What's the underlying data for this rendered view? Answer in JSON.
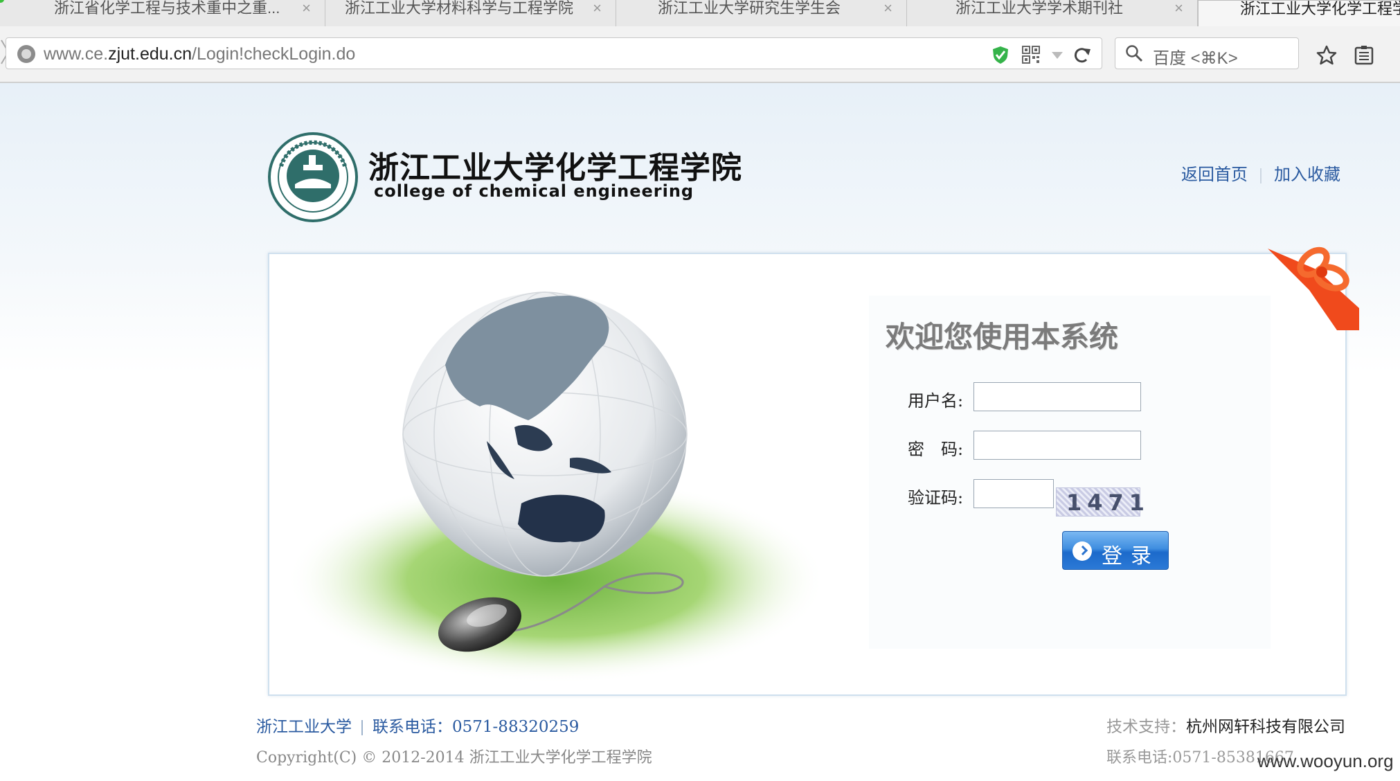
{
  "browser": {
    "tabs": [
      {
        "title": "浙江省化学工程与技术重中之重...",
        "close": "×"
      },
      {
        "title": "浙江工业大学材料科学与工程学院",
        "close": "×"
      },
      {
        "title": "浙江工业大学研究生学生会",
        "close": "×"
      },
      {
        "title": "浙江工业大学学术期刊社",
        "close": "×"
      },
      {
        "title": "浙江工业大学化学工程学",
        "close": ""
      }
    ],
    "url_prefix": "www.ce.",
    "url_domain": "zjut.edu.cn",
    "url_path": "/Login!checkLogin.do",
    "search_placeholder": "百度 <⌘K>",
    "icons": [
      "globe-icon",
      "shield-check-icon",
      "qrcode-icon",
      "dropdown-triangle-icon",
      "reload-icon",
      "search-icon",
      "star-icon",
      "reading-list-icon"
    ]
  },
  "header": {
    "title": "浙江工业大学化学工程学院",
    "subtitle": "college of chemical engineering",
    "links": [
      "返回首页",
      "加入收藏"
    ]
  },
  "login": {
    "welcome": "欢迎您使用本系统",
    "username_label": "用户名:",
    "password_label": "密　码:",
    "captcha_label": "验证码:",
    "username_value": "",
    "password_value": "",
    "captcha_value": "",
    "captcha_text": "1471",
    "button_label": "登录"
  },
  "footer": {
    "university": "浙江工业大学",
    "phone": "联系电话：0571-88320259",
    "copyright": "Copyright(C) © 2012-2014 浙江工业大学化学工程学院",
    "support_label": "技术支持：",
    "support_company": "杭州网轩科技有限公司",
    "support_phone": "联系电话:0571-85381667"
  },
  "watermark": "www.wooyun.org",
  "colors": {
    "link_blue": "#2a5aa0",
    "button_blue": "#2c74cf",
    "ribbon_red": "#f04a1c"
  }
}
